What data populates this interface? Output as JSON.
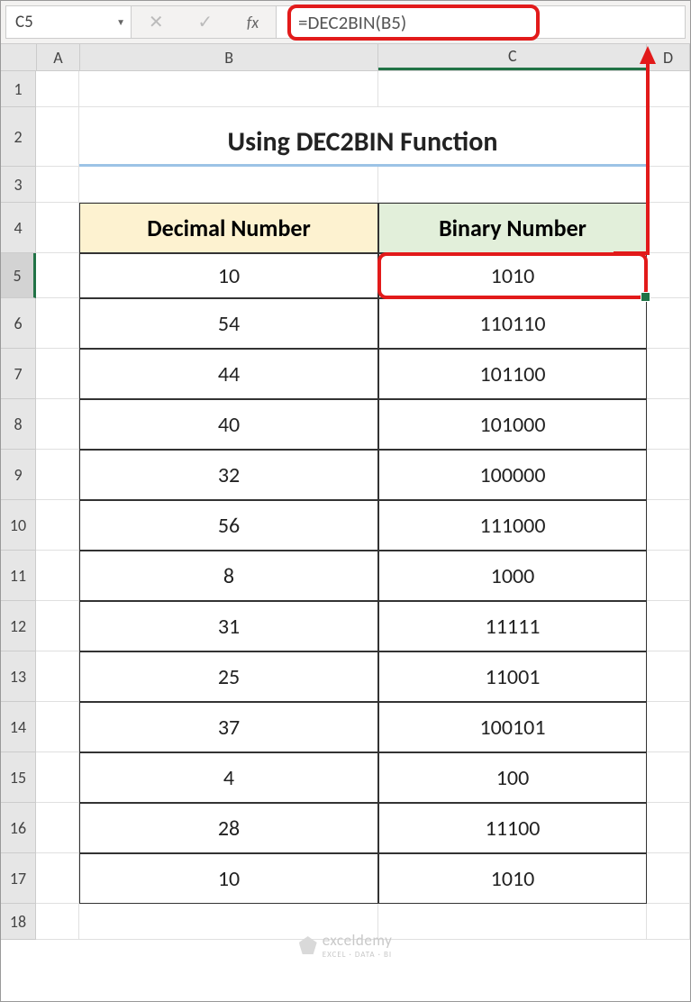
{
  "nameBox": "C5",
  "formula": "=DEC2BIN(B5)",
  "columns": {
    "A": "A",
    "B": "B",
    "C": "C",
    "D": "D"
  },
  "rowLabels": [
    "1",
    "2",
    "3",
    "4",
    "5",
    "6",
    "7",
    "8",
    "9",
    "10",
    "11",
    "12",
    "13",
    "14",
    "15",
    "16",
    "17",
    "18"
  ],
  "title": "Using DEC2BIN Function",
  "headers": {
    "decimal": "Decimal Number",
    "binary": "Binary Number"
  },
  "rows": [
    {
      "dec": "10",
      "bin": "1010"
    },
    {
      "dec": "54",
      "bin": "110110"
    },
    {
      "dec": "44",
      "bin": "101100"
    },
    {
      "dec": "40",
      "bin": "101000"
    },
    {
      "dec": "32",
      "bin": "100000"
    },
    {
      "dec": "56",
      "bin": "111000"
    },
    {
      "dec": "8",
      "bin": "1000"
    },
    {
      "dec": "31",
      "bin": "11111"
    },
    {
      "dec": "25",
      "bin": "11001"
    },
    {
      "dec": "37",
      "bin": "100101"
    },
    {
      "dec": "4",
      "bin": "100"
    },
    {
      "dec": "28",
      "bin": "11100"
    },
    {
      "dec": "10",
      "bin": "1010"
    }
  ],
  "watermark": {
    "text": "exceldemy",
    "sub": "EXCEL · DATA · BI"
  },
  "fxLabel": "fx"
}
